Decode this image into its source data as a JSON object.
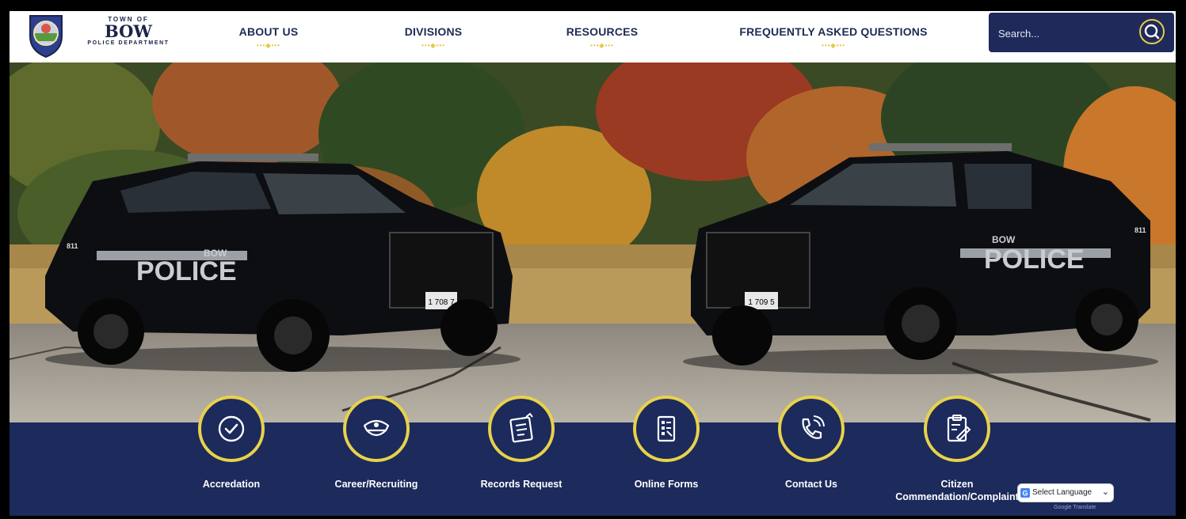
{
  "logo": {
    "top_text": "TOWN OF",
    "main_text": "BOW",
    "bottom_text": "POLICE DEPARTMENT"
  },
  "nav": [
    {
      "label": "ABOUT US"
    },
    {
      "label": "DIVISIONS"
    },
    {
      "label": "RESOURCES"
    },
    {
      "label": "FREQUENTLY ASKED QUESTIONS"
    }
  ],
  "nav_dots": "•••◆•••",
  "search": {
    "placeholder": "Search...",
    "icon": "search-icon"
  },
  "hero": {
    "car_left": {
      "label_bow": "BOW",
      "label_police": "POLICE",
      "plate": "1 708 7",
      "unit": "811"
    },
    "car_right": {
      "label_bow": "BOW",
      "label_police": "POLICE",
      "plate": "1 709 5",
      "unit": "811"
    }
  },
  "quick_links": [
    {
      "label": "Accredation",
      "icon": "check-circle-icon"
    },
    {
      "label": "Career/Recruiting",
      "icon": "police-cap-icon"
    },
    {
      "label": "Records Request",
      "icon": "document-request-icon"
    },
    {
      "label": "Online Forms",
      "icon": "form-icon"
    },
    {
      "label": "Contact Us",
      "icon": "phone-icon"
    },
    {
      "label": "Citizen Commendation/Complaint",
      "icon": "clipboard-pen-icon"
    }
  ],
  "language": {
    "label": "Select Language",
    "powered": "Google Translate"
  },
  "colors": {
    "navy": "#1c2a5c",
    "gold": "#e8d24a",
    "header_text": "#1f2a55"
  }
}
